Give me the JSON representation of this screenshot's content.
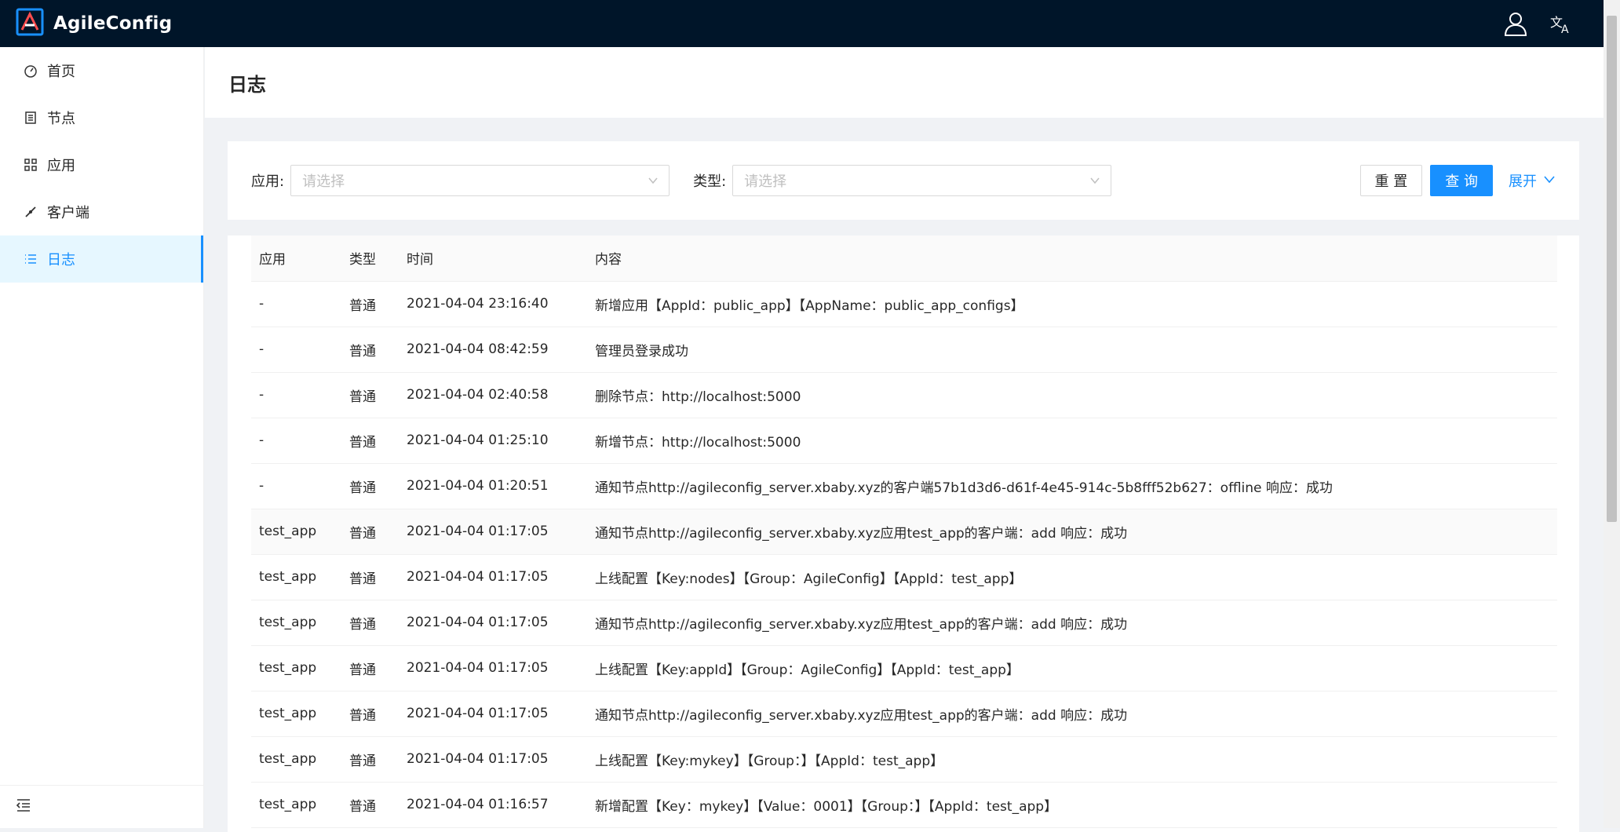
{
  "app": {
    "title": "AgileConfig"
  },
  "sidebar": {
    "items": [
      {
        "label": "首页",
        "icon": "dashboard-icon"
      },
      {
        "label": "节点",
        "icon": "node-list-icon"
      },
      {
        "label": "应用",
        "icon": "apps-grid-icon"
      },
      {
        "label": "客户端",
        "icon": "client-icon"
      },
      {
        "label": "日志",
        "icon": "log-list-icon",
        "active": true
      }
    ],
    "collapse_icon": "menu-fold-icon"
  },
  "page": {
    "title": "日志"
  },
  "filter": {
    "app_label": "应用:",
    "app_placeholder": "请选择",
    "type_label": "类型:",
    "type_placeholder": "请选择",
    "reset": "重 置",
    "query": "查 询",
    "expand": "展开"
  },
  "table": {
    "columns": [
      "应用",
      "类型",
      "时间",
      "内容"
    ],
    "rows": [
      {
        "app": "-",
        "type": "普通",
        "time": "2021-04-04 23:16:40",
        "content": "新增应用【AppId：public_app】【AppName：public_app_configs】"
      },
      {
        "app": "-",
        "type": "普通",
        "time": "2021-04-04 08:42:59",
        "content": "管理员登录成功"
      },
      {
        "app": "-",
        "type": "普通",
        "time": "2021-04-04 02:40:58",
        "content": "删除节点：http://localhost:5000"
      },
      {
        "app": "-",
        "type": "普通",
        "time": "2021-04-04 01:25:10",
        "content": "新增节点：http://localhost:5000"
      },
      {
        "app": "-",
        "type": "普通",
        "time": "2021-04-04 01:20:51",
        "content": "通知节点http://agileconfig_server.xbaby.xyz的客户端57b1d3d6-d61f-4e45-914c-5b8fff52b627：offline 响应：成功"
      },
      {
        "app": "test_app",
        "type": "普通",
        "time": "2021-04-04 01:17:05",
        "content": "通知节点http://agileconfig_server.xbaby.xyz应用test_app的客户端：add 响应：成功"
      },
      {
        "app": "test_app",
        "type": "普通",
        "time": "2021-04-04 01:17:05",
        "content": "上线配置【Key:nodes】【Group：AgileConfig】【AppId：test_app】"
      },
      {
        "app": "test_app",
        "type": "普通",
        "time": "2021-04-04 01:17:05",
        "content": "通知节点http://agileconfig_server.xbaby.xyz应用test_app的客户端：add 响应：成功"
      },
      {
        "app": "test_app",
        "type": "普通",
        "time": "2021-04-04 01:17:05",
        "content": "上线配置【Key:appId】【Group：AgileConfig】【AppId：test_app】"
      },
      {
        "app": "test_app",
        "type": "普通",
        "time": "2021-04-04 01:17:05",
        "content": "通知节点http://agileconfig_server.xbaby.xyz应用test_app的客户端：add 响应：成功"
      },
      {
        "app": "test_app",
        "type": "普通",
        "time": "2021-04-04 01:17:05",
        "content": "上线配置【Key:mykey】【Group：】【AppId：test_app】"
      },
      {
        "app": "test_app",
        "type": "普通",
        "time": "2021-04-04 01:16:57",
        "content": "新增配置【Key：mykey】【Value：0001】【Group：】【AppId：test_app】"
      }
    ]
  },
  "colors": {
    "header_bg": "#001529",
    "primary": "#1890ff",
    "active_bg": "#e6f7ff"
  }
}
